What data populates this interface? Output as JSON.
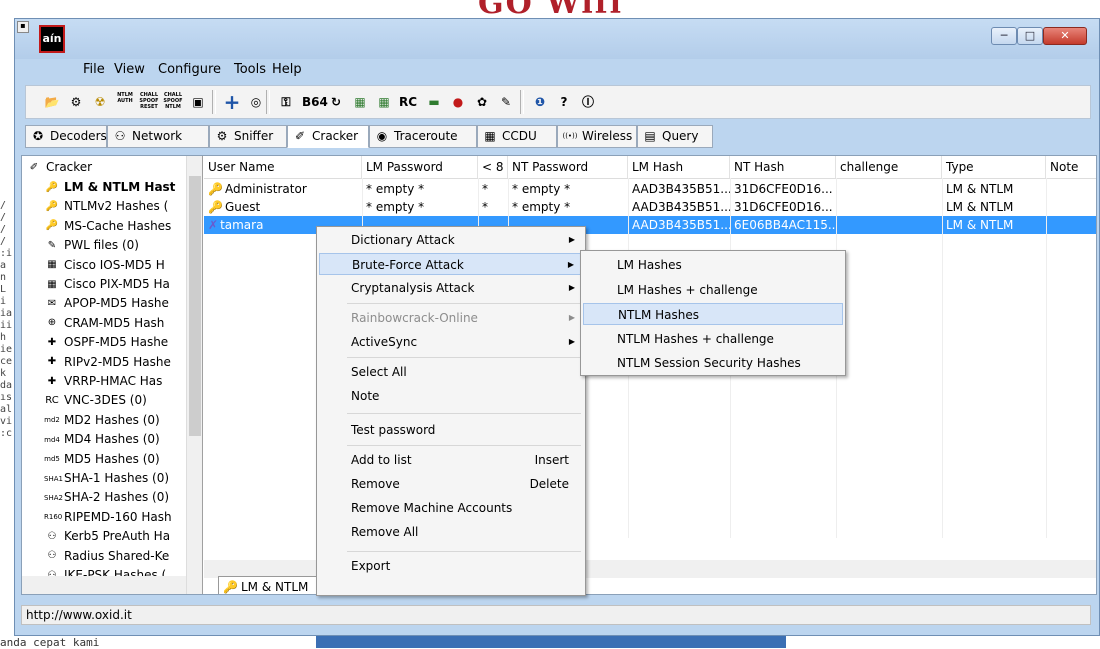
{
  "background": {
    "title": "GO Wifi",
    "bottom_text": "anda cepat kami",
    "left_fragments": "/ / / / :i a n L i ia ii h ie ce k da ıs al vi :c"
  },
  "window": {
    "app_icon_text": "aín",
    "sys_box": "▪",
    "min": "─",
    "max": "□",
    "close": "✕"
  },
  "menu": [
    "File",
    "View",
    "Configure",
    "Tools",
    "Help"
  ],
  "toolbar_icons": [
    {
      "glyph": "📂",
      "name": "open-icon"
    },
    {
      "glyph": "⚙",
      "name": "add-icon"
    },
    {
      "glyph": "☢",
      "name": "radiation-icon"
    },
    {
      "glyph": "NTLM AUTH",
      "name": "ntlm-auth-icon"
    },
    {
      "glyph": "CHALL SPOOF RESET",
      "name": "chall-spoof-reset-icon"
    },
    {
      "glyph": "CHALL SPOOF NTLM",
      "name": "chall-spoof-ntlm-icon"
    },
    {
      "glyph": "▣",
      "name": "export-icon"
    },
    {
      "glyph": "+",
      "name": "plus-icon"
    },
    {
      "glyph": "◎",
      "name": "remove-icon"
    },
    {
      "glyph": "⚿",
      "name": "config-icon"
    },
    {
      "glyph": "B64",
      "name": "base64-icon"
    },
    {
      "glyph": "↻",
      "name": "refresh-icon"
    },
    {
      "glyph": "▦",
      "name": "table1-icon"
    },
    {
      "glyph": "▦",
      "name": "table2-icon"
    },
    {
      "glyph": "RC",
      "name": "vnc-icon"
    },
    {
      "glyph": "▬",
      "name": "wire-icon"
    },
    {
      "glyph": "●",
      "name": "record-icon"
    },
    {
      "glyph": "✿",
      "name": "flower-icon"
    },
    {
      "glyph": "✎",
      "name": "edit-icon"
    },
    {
      "glyph": "❶",
      "name": "info-icon"
    },
    {
      "glyph": "?",
      "name": "help-icon"
    },
    {
      "glyph": "Ⓘ",
      "name": "about-icon"
    }
  ],
  "tabs": [
    {
      "label": "Decoders",
      "glyph": "✪"
    },
    {
      "label": "Network",
      "glyph": "⚇"
    },
    {
      "label": "Sniffer",
      "glyph": "⚙"
    },
    {
      "label": "Cracker",
      "glyph": "✐"
    },
    {
      "label": "Traceroute",
      "glyph": "◉"
    },
    {
      "label": "CCDU",
      "glyph": "▦"
    },
    {
      "label": "Wireless",
      "glyph": "((•))"
    },
    {
      "label": "Query",
      "glyph": "▤"
    }
  ],
  "tree": {
    "root": "Cracker",
    "items": [
      {
        "label": "LM & NTLM Hast",
        "glyph": "🔑",
        "bold": true
      },
      {
        "label": "NTLMv2 Hashes (",
        "glyph": "🔑"
      },
      {
        "label": "MS-Cache Hashes",
        "glyph": "🔑"
      },
      {
        "label": "PWL files (0)",
        "glyph": "✎"
      },
      {
        "label": "Cisco IOS-MD5 H",
        "glyph": "▦"
      },
      {
        "label": "Cisco PIX-MD5 Ha",
        "glyph": "▦"
      },
      {
        "label": "APOP-MD5 Hashe",
        "glyph": "✉"
      },
      {
        "label": "CRAM-MD5 Hash",
        "glyph": "⊕"
      },
      {
        "label": "OSPF-MD5 Hashe",
        "glyph": "✚"
      },
      {
        "label": "RIPv2-MD5 Hashe",
        "glyph": "✚"
      },
      {
        "label": "VRRP-HMAC Has",
        "glyph": "✚"
      },
      {
        "label": "VNC-3DES (0)",
        "glyph": "RC"
      },
      {
        "label": "MD2 Hashes (0)",
        "glyph": "md2"
      },
      {
        "label": "MD4 Hashes (0)",
        "glyph": "md4"
      },
      {
        "label": "MD5 Hashes (0)",
        "glyph": "md5"
      },
      {
        "label": "SHA-1 Hashes (0)",
        "glyph": "SHA1"
      },
      {
        "label": "SHA-2 Hashes (0)",
        "glyph": "SHA2"
      },
      {
        "label": "RIPEMD-160 Hash",
        "glyph": "R160"
      },
      {
        "label": "Kerb5 PreAuth Ha",
        "glyph": "⚇"
      },
      {
        "label": "Radius Shared-Ke",
        "glyph": "⚇"
      },
      {
        "label": "IKE-PSK Hashes (",
        "glyph": "⚇"
      }
    ]
  },
  "columns": [
    "User Name",
    "LM Password",
    "< 8",
    "NT Password",
    "LM Hash",
    "NT Hash",
    "challenge",
    "Type",
    "Note"
  ],
  "rows": [
    {
      "user": "Administrator",
      "lm": "* empty *",
      "lt8": "*",
      "nt": "* empty *",
      "lmhash": "AAD3B435B51...",
      "nthash": "31D6CFE0D16...",
      "chal": "",
      "type": "LM & NTLM",
      "note": "",
      "glyph": "🔑"
    },
    {
      "user": "Guest",
      "lm": "* empty *",
      "lt8": "*",
      "nt": "* empty *",
      "lmhash": "AAD3B435B51...",
      "nthash": "31D6CFE0D16...",
      "chal": "",
      "type": "LM & NTLM",
      "note": "",
      "glyph": "🔑"
    },
    {
      "user": "tamara",
      "lm": "",
      "lt8": "",
      "nt": "",
      "lmhash": "AAD3B435B51...",
      "nthash": "6E06BB4AC115...",
      "chal": "",
      "type": "LM & NTLM",
      "note": "",
      "glyph": "✗"
    }
  ],
  "bottom_tab": "LM & NTLM",
  "status": "http://www.oxid.it",
  "context_menu": [
    {
      "label": "Dictionary Attack",
      "sub": true
    },
    {
      "label": "Brute-Force Attack",
      "sub": true,
      "hl": true
    },
    {
      "label": "Cryptanalysis Attack",
      "sub": true
    },
    {
      "label": "Rainbowcrack-Online",
      "sub": true,
      "dis": true
    },
    {
      "label": "ActiveSync",
      "sub": true
    },
    {
      "label": "Select All"
    },
    {
      "label": "Note"
    },
    {
      "label": "Test password"
    },
    {
      "label": "Add to list",
      "shortcut": "Insert"
    },
    {
      "label": "Remove",
      "shortcut": "Delete"
    },
    {
      "label": "Remove Machine Accounts"
    },
    {
      "label": "Remove All"
    },
    {
      "label": "Export"
    }
  ],
  "submenu": [
    {
      "label": "LM Hashes"
    },
    {
      "label": "LM Hashes + challenge"
    },
    {
      "label": "NTLM Hashes",
      "hl": true
    },
    {
      "label": "NTLM Hashes + challenge"
    },
    {
      "label": "NTLM Session Security Hashes"
    }
  ]
}
